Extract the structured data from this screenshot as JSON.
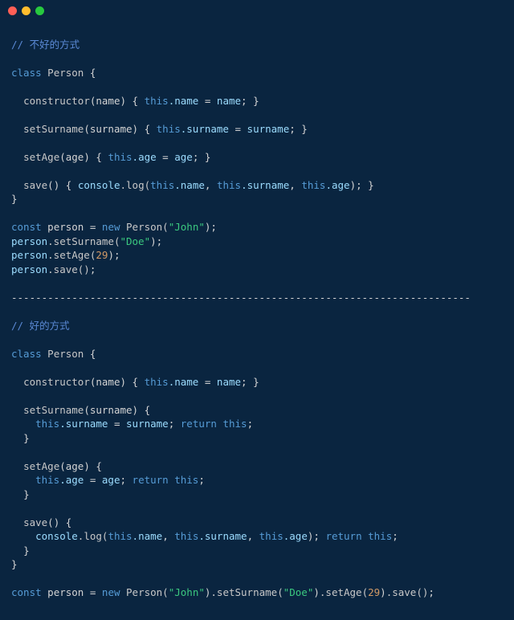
{
  "window": {
    "controls": [
      "close",
      "minimize",
      "maximize"
    ]
  },
  "code": {
    "bad_comment": "// 不好的方式",
    "good_comment": "// 好的方式",
    "class_decl": "class Person {",
    "ctor_open": "constructor(name) {",
    "ctor_body_this": "this",
    "ctor_body_prop": ".name",
    "ctor_body_eq": " = ",
    "ctor_body_param": "name",
    "ctor_body_close": "; }",
    "setSurname_sig": "setSurname(surname) {",
    "setSurname_this": "this",
    "setSurname_prop": ".surname",
    "setSurname_param": "surname",
    "setAge_sig": "setAge(age) {",
    "setAge_this": "this",
    "setAge_prop": ".age",
    "setAge_param": "age",
    "save_sig": "save() {",
    "console": "console",
    "log": ".log(",
    "comma": ", ",
    "close_paren": ")",
    "semi_close": "; }",
    "brace_close": "}",
    "return_kw": "return",
    "this_kw": "this",
    "semi": ";",
    "const_kw": "const",
    "person_var": " person ",
    "eq": "= ",
    "new_kw": "new",
    "person_call": " Person(",
    "john": "\"John\"",
    "doe": "\"Doe\"",
    "age29": "29",
    "call_setSurname": ".setSurname(",
    "call_setAge": ".setAge(",
    "call_save": ".save()",
    "call_close": ");",
    "person_ident": "person",
    "divider": "----------------------------------------------------------------------------"
  }
}
